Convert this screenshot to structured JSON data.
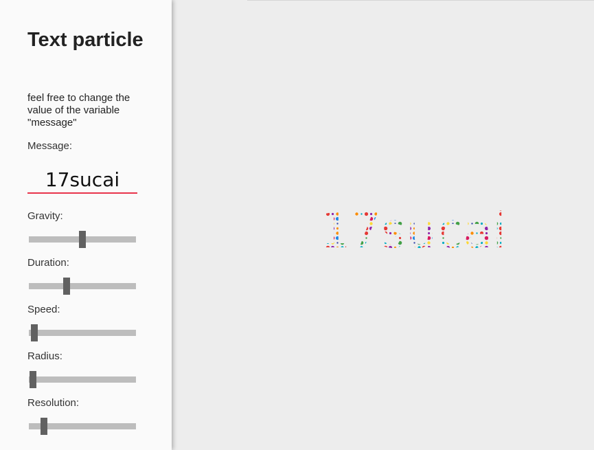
{
  "sidebar": {
    "title": "Text particle",
    "description": "feel free to change the value of the variable \"message\"",
    "message_label": "Message:",
    "message_value": "17sucai",
    "controls": [
      {
        "name": "gravity",
        "label": "Gravity:",
        "value": 0.5
      },
      {
        "name": "duration",
        "label": "Duration:",
        "value": 0.35
      },
      {
        "name": "speed",
        "label": "Speed:",
        "value": 0.05
      },
      {
        "name": "radius",
        "label": "Radius:",
        "value": 0.04
      },
      {
        "name": "resolution",
        "label": "Resolution:",
        "value": 0.14
      }
    ]
  },
  "canvas": {
    "text": "17sucai",
    "particle_colors": [
      "#e53935",
      "#fb8c00",
      "#fdd835",
      "#43a047",
      "#1e88e5",
      "#8e24aa",
      "#00acc1",
      "#3949ab",
      "#d81b60"
    ]
  },
  "colors": {
    "accent": "#e8334a",
    "track": "#bdbdbd",
    "thumb": "#616161"
  }
}
